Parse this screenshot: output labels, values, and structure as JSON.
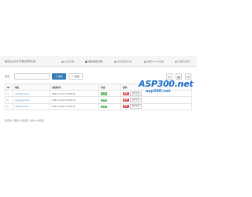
{
  "header": {
    "title": "圆佳点点号专属站群系统",
    "nav": [
      {
        "label": "站点管理",
        "icon": "home-icon"
      },
      {
        "label": "域名绑定管理",
        "icon": "globe-icon"
      },
      {
        "label": "域名提取记录",
        "icon": "list-icon"
      },
      {
        "label": "更新Token管理",
        "icon": "key-icon"
      },
      {
        "label": "管理员设置",
        "icon": "user-icon"
      }
    ]
  },
  "search": {
    "label": "搜索",
    "placeholder": "",
    "search_button": "搜索",
    "reset_button": "重置"
  },
  "table": {
    "columns": [
      "ID",
      "域名",
      "添加时间",
      "状态",
      "操作"
    ],
    "rows": [
      {
        "id": "3",
        "domain": "xx.xxxx.com",
        "time": "2022-10-31 16:08:01",
        "status": "正常",
        "delete": "删除",
        "edit": "更新记录"
      },
      {
        "id": "2",
        "domain": "yyy.yyyy.com",
        "time": "2022-10-20 09:36:02",
        "status": "正常",
        "delete": "删除",
        "edit": "更新记录"
      },
      {
        "id": "1",
        "domain": "domain.com",
        "time": "2022-10-20 10:26:21",
        "status": "正常",
        "delete": "删除",
        "edit": "更新记录"
      }
    ]
  },
  "summary": "显示第 1 到第 3 条记录，总共 3 条记录",
  "watermark": {
    "logo": "ASP300.net",
    "url": "asp300.net"
  },
  "colors": {
    "primary": "#337ab7",
    "success": "#5cb85c",
    "danger": "#d9534f"
  }
}
